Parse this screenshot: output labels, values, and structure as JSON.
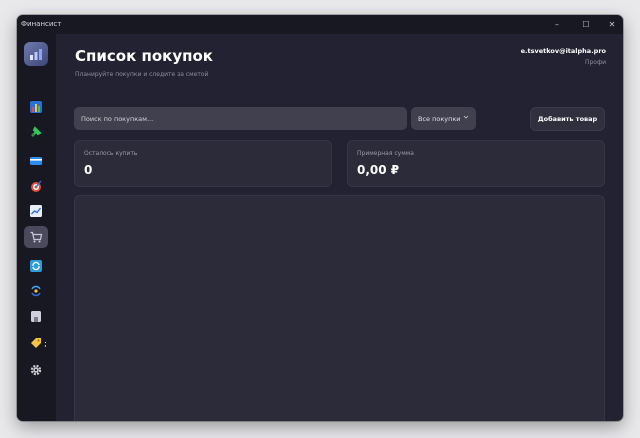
{
  "window": {
    "app_title": "Финансист"
  },
  "title_controls": {
    "minimize": "–",
    "maximize": "☐",
    "close": "✕"
  },
  "sidebar": {
    "items": [
      {
        "icon": "bar-chart-icon",
        "color": "#3fbf6f"
      },
      {
        "icon": "pin-icon",
        "color": "#34c759"
      },
      {
        "icon": "credit-card-icon",
        "color": "#2d8cf0"
      },
      {
        "icon": "target-icon",
        "color": "#e74c3c"
      },
      {
        "icon": "trend-chart-icon",
        "color": "#4a90e2"
      },
      {
        "icon": "shopping-cart-icon",
        "color": "#b8b8c8",
        "active": true
      },
      {
        "icon": "refresh-icon",
        "color": "#2d9cdb"
      },
      {
        "icon": "exchange-icon",
        "color": "#3fa9f5"
      },
      {
        "icon": "bank-icon",
        "color": "#c8c8d4"
      },
      {
        "icon": "tag-icon",
        "color": "#f5c542"
      },
      {
        "icon": "gear-icon",
        "color": "#c8c8d0"
      }
    ],
    "tag_suffix": ";"
  },
  "header": {
    "title": "Список покупок",
    "subtitle": "Планируйте покупки и следите за сметой",
    "user_email": "e.tsvetkov@italpha.pro",
    "user_plan": "Профи"
  },
  "toolbar": {
    "search_placeholder": "Поиск по покупкам...",
    "filter_value": "Все покупки",
    "add_label": "Добавить товар"
  },
  "stats": {
    "remaining_label": "Осталось купить",
    "remaining_value": "0",
    "sum_label": "Примерная сумма",
    "sum_value": "0,00 ₽"
  }
}
